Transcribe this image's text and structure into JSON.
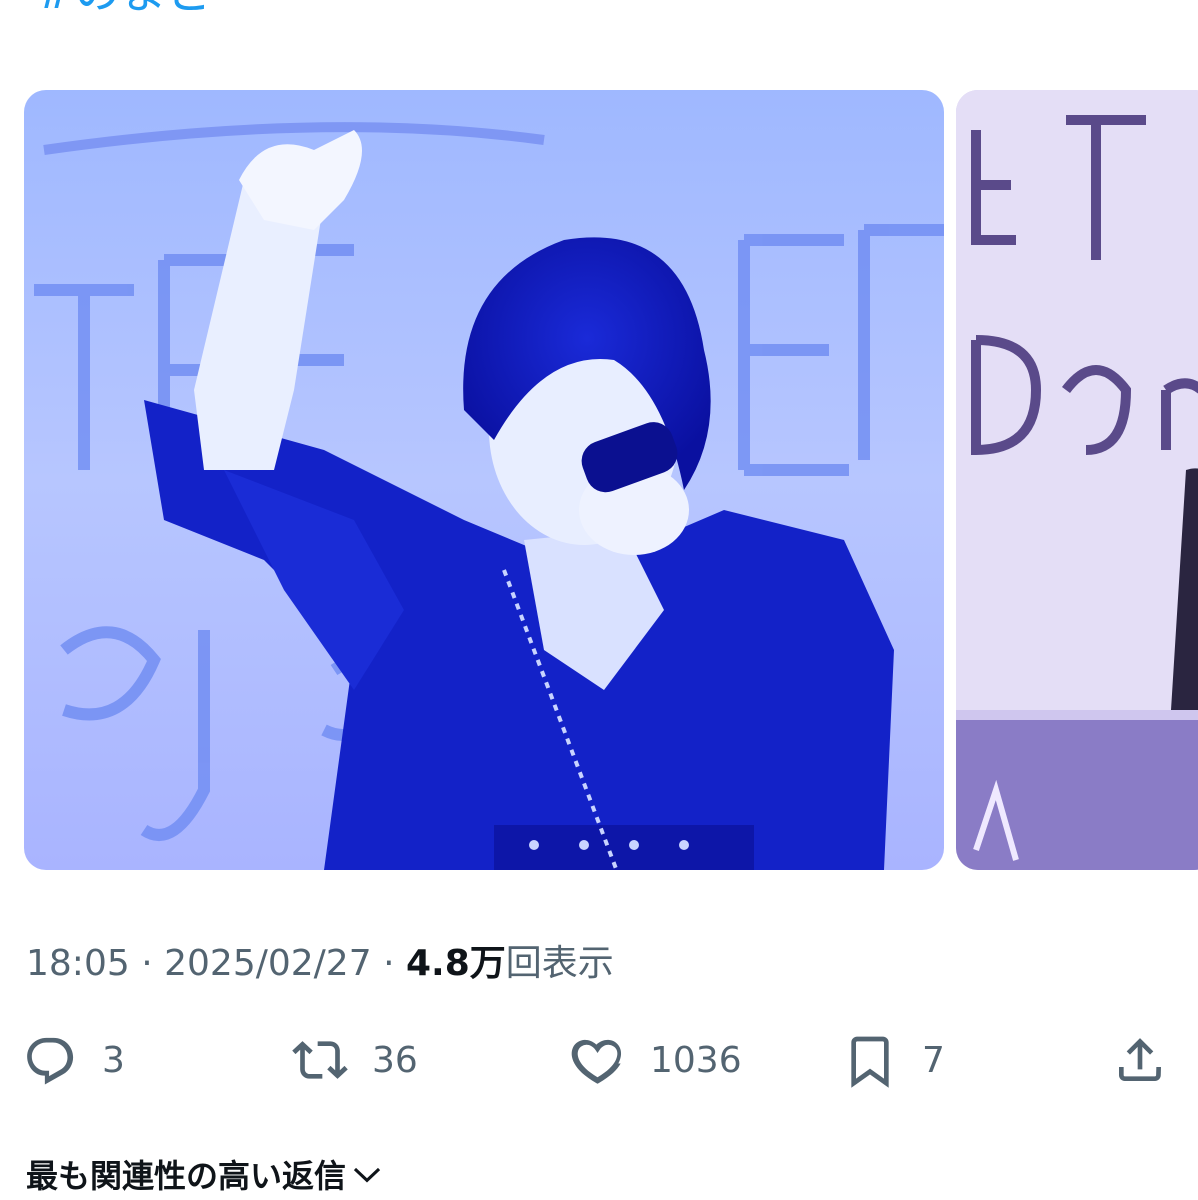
{
  "tweet": {
    "hashtag": "#のまど",
    "time": "18:05",
    "separator": "·",
    "date": "2025/02/27",
    "views_number": "4.8万",
    "views_suffix": "回表示"
  },
  "media": [
    {
      "icon": "photo-performer-singing",
      "tint": "#3f5ff0"
    },
    {
      "icon": "photo-stage-partial",
      "tint": "#9b8fd8"
    }
  ],
  "actions": {
    "reply": {
      "icon": "reply-icon",
      "count": "3"
    },
    "retweet": {
      "icon": "retweet-icon",
      "count": "36"
    },
    "like": {
      "icon": "heart-icon",
      "count": "1036"
    },
    "bookmark": {
      "icon": "bookmark-icon",
      "count": "7"
    },
    "share": {
      "icon": "share-icon"
    }
  },
  "replies": {
    "sort_label": "最も関連性の高い返信"
  },
  "colors": {
    "link": "#1d9bf0",
    "secondary_text": "#536471",
    "primary_text": "#0f1419"
  }
}
